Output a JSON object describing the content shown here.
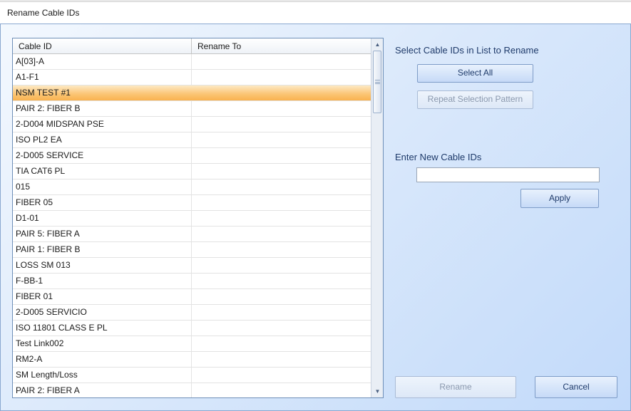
{
  "window": {
    "title": "Rename Cable IDs"
  },
  "grid": {
    "columns": [
      "Cable ID",
      "Rename To"
    ],
    "rows": [
      {
        "cable_id": "A[03]-A",
        "rename_to": ""
      },
      {
        "cable_id": "A1-F1",
        "rename_to": ""
      },
      {
        "cable_id": "NSM TEST #1",
        "rename_to": "",
        "selected": true
      },
      {
        "cable_id": "PAIR 2: FIBER B",
        "rename_to": ""
      },
      {
        "cable_id": "2-D004 MIDSPAN PSE",
        "rename_to": ""
      },
      {
        "cable_id": "ISO PL2 EA",
        "rename_to": ""
      },
      {
        "cable_id": "2-D005 SERVICE",
        "rename_to": ""
      },
      {
        "cable_id": "TIA CAT6 PL",
        "rename_to": ""
      },
      {
        "cable_id": "015",
        "rename_to": ""
      },
      {
        "cable_id": "FIBER 05",
        "rename_to": ""
      },
      {
        "cable_id": "D1-01",
        "rename_to": ""
      },
      {
        "cable_id": "PAIR 5: FIBER A",
        "rename_to": ""
      },
      {
        "cable_id": "PAIR 1: FIBER B",
        "rename_to": ""
      },
      {
        "cable_id": "LOSS SM 013",
        "rename_to": ""
      },
      {
        "cable_id": "F-BB-1",
        "rename_to": ""
      },
      {
        "cable_id": "FIBER 01",
        "rename_to": ""
      },
      {
        "cable_id": "2-D005 SERVICIO",
        "rename_to": ""
      },
      {
        "cable_id": "ISO 11801 CLASS E PL",
        "rename_to": ""
      },
      {
        "cable_id": "Test Link002",
        "rename_to": ""
      },
      {
        "cable_id": "RM2-A",
        "rename_to": ""
      },
      {
        "cable_id": "SM Length/Loss",
        "rename_to": ""
      },
      {
        "cable_id": "PAIR 2: FIBER A",
        "rename_to": ""
      }
    ]
  },
  "selection": {
    "heading": "Select Cable IDs in List to Rename",
    "select_all_label": "Select All",
    "repeat_pattern_label": "Repeat Selection Pattern"
  },
  "new_ids": {
    "heading": "Enter New Cable IDs",
    "value": "",
    "placeholder": "",
    "apply_label": "Apply"
  },
  "footer": {
    "rename_label": "Rename",
    "cancel_label": "Cancel"
  },
  "colors": {
    "selected_row": "#f9b24f",
    "accent_text": "#1e3a6a",
    "panel_gradient_end": "#c2dafa"
  }
}
